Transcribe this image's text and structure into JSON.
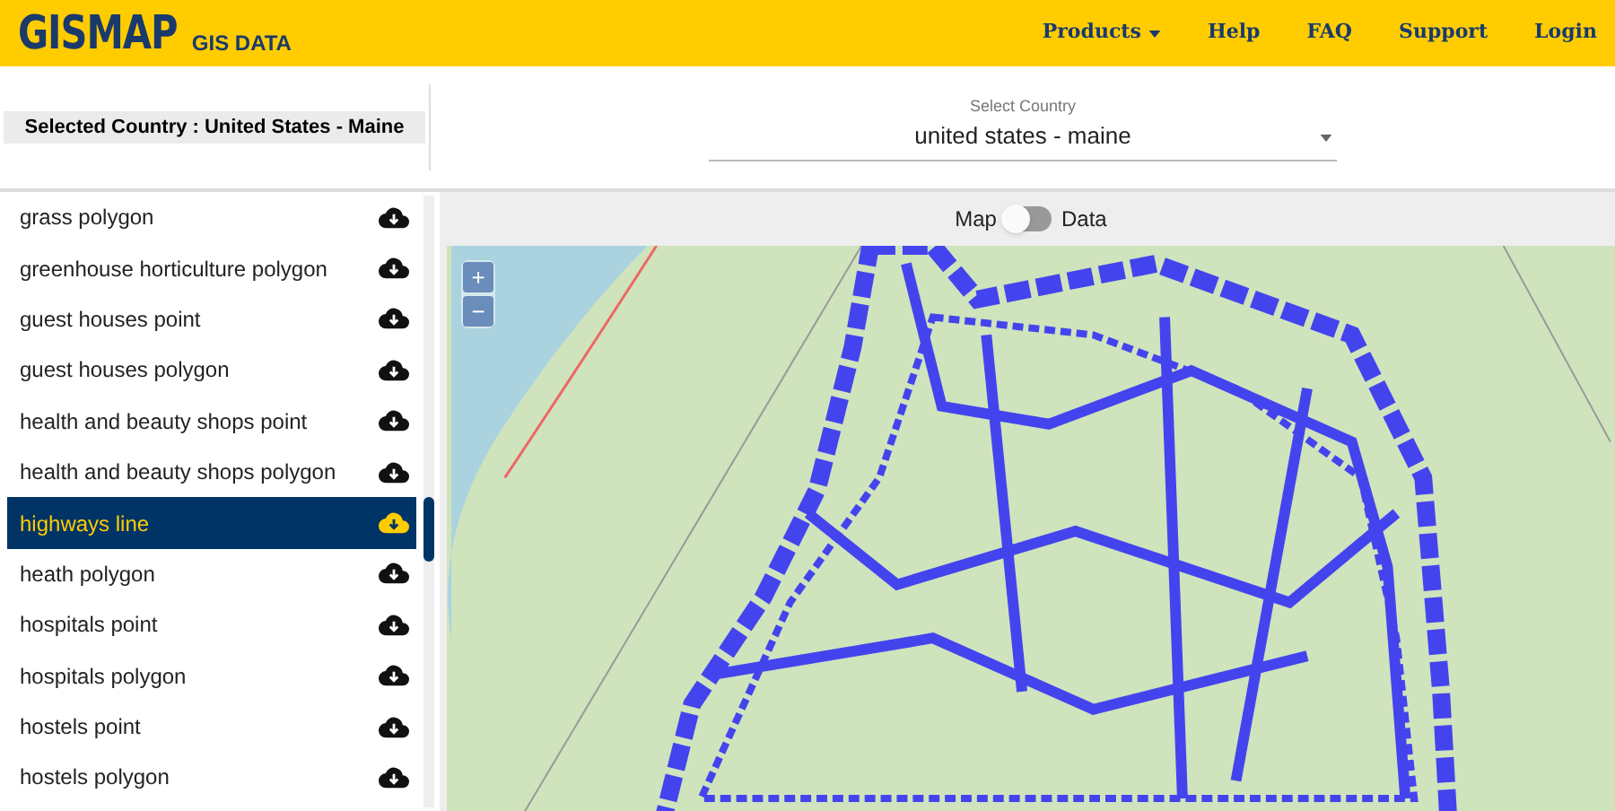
{
  "header": {
    "logo": "GISMAP",
    "logo_suffix": "GIS DATA",
    "nav": [
      {
        "label": "Products",
        "dropdown": true
      },
      {
        "label": "Help",
        "dropdown": false
      },
      {
        "label": "FAQ",
        "dropdown": false
      },
      {
        "label": "Support",
        "dropdown": false
      },
      {
        "label": "Login",
        "dropdown": false
      }
    ]
  },
  "selected_country": "Selected Country : United States - Maine",
  "country_select": {
    "label": "Select Country",
    "value": "united states - maine"
  },
  "layers": [
    {
      "label": "grass polygon",
      "selected": false
    },
    {
      "label": "greenhouse horticulture polygon",
      "selected": false
    },
    {
      "label": "guest houses point",
      "selected": false
    },
    {
      "label": "guest houses polygon",
      "selected": false
    },
    {
      "label": "health and beauty shops point",
      "selected": false
    },
    {
      "label": "health and beauty shops polygon",
      "selected": false
    },
    {
      "label": "highways line",
      "selected": true
    },
    {
      "label": "heath polygon",
      "selected": false
    },
    {
      "label": "hospitals point",
      "selected": false
    },
    {
      "label": "hospitals polygon",
      "selected": false
    },
    {
      "label": "hostels point",
      "selected": false
    },
    {
      "label": "hostels polygon",
      "selected": false
    }
  ],
  "view_toggle": {
    "left_label": "Map",
    "right_label": "Data",
    "on": false
  },
  "map": {
    "zoom_in": "+",
    "zoom_out": "−"
  }
}
